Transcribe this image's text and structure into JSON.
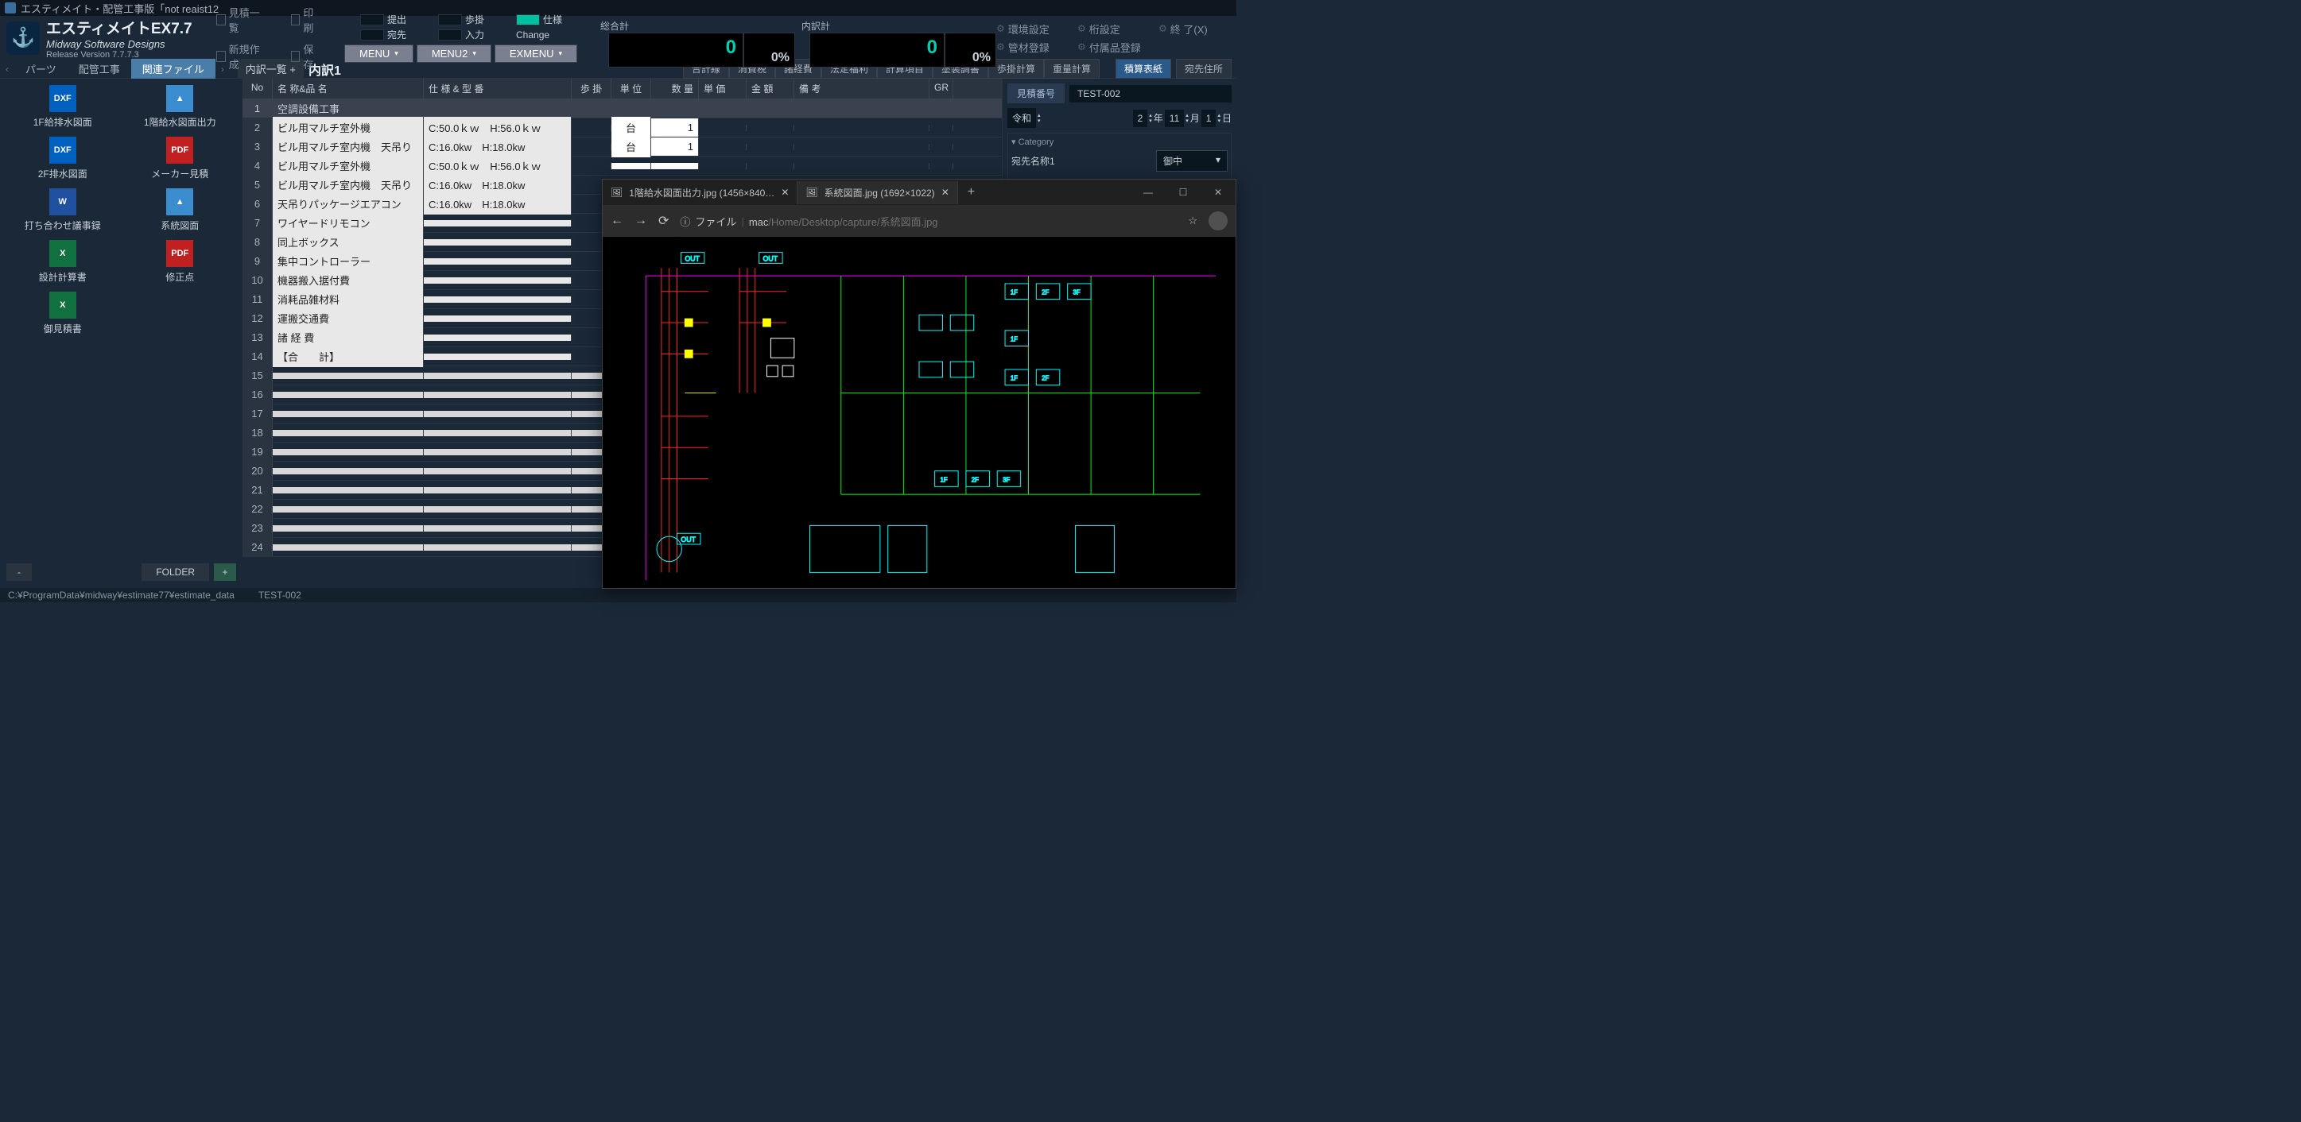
{
  "title": "エスティメイト・配管工事版「not reaist12",
  "logo": {
    "t1": "エスティメイトEX7.7",
    "t2": "Midway Software Designs",
    "t3": "Release Version 7.7.7.3"
  },
  "hdr_left": {
    "a": "見積一覧",
    "b": "印 刷",
    "c": "新規作成",
    "d": "保 存"
  },
  "toggles": {
    "a": "提出",
    "b": "歩掛",
    "c": "仕様",
    "d": "宛先",
    "e": "入力",
    "f": "Change"
  },
  "menus": {
    "a": "MENU",
    "b": "MENU2",
    "c": "EXMENU"
  },
  "totals": {
    "l1": "総合計",
    "v1": "0",
    "p1": "0%",
    "l2": "内訳計",
    "v2": "0",
    "p2": "0%"
  },
  "rbtns": {
    "a": "環境設定",
    "b": "桁設定",
    "c": "終 了(X)",
    "d": "管材登録",
    "e": "付属品登録"
  },
  "nav": {
    "a": "パーツ",
    "b": "配管工事",
    "c": "関連ファイル"
  },
  "bread": {
    "list": "内訳一覧",
    "cur": "内訳1"
  },
  "fn": [
    "合計線",
    "消費税",
    "諸経費",
    "法定福利",
    "計算項目",
    "塗装調書",
    "歩掛計算",
    "重量計算"
  ],
  "files": [
    {
      "icon": "dxf",
      "label": "1F給排水図面"
    },
    {
      "icon": "img",
      "label": "1階給水図面出力"
    },
    {
      "icon": "dxf",
      "label": "2F排水図面"
    },
    {
      "icon": "pdf",
      "label": "メーカー見積"
    },
    {
      "icon": "doc",
      "label": "打ち合わせ議事録"
    },
    {
      "icon": "img",
      "label": "系統図面"
    },
    {
      "icon": "xls",
      "label": "設計計算書"
    },
    {
      "icon": "pdf",
      "label": "修正点"
    },
    {
      "icon": "xls",
      "label": "御見積書"
    }
  ],
  "left_foot": {
    "folder": "FOLDER",
    "plus": "+",
    "dash": "-"
  },
  "cols": {
    "no": "No",
    "name": "名 称&品 名",
    "spec": "仕 様 & 型 番",
    "step": "歩 掛",
    "unit": "単 位",
    "qty": "数 量",
    "price": "単 価",
    "amt": "金 額",
    "note": "備 考",
    "gr": "GR"
  },
  "rows": [
    {
      "no": 1,
      "name": "空調設備工事",
      "spec": "",
      "unit": "",
      "qty": "",
      "hdr": true
    },
    {
      "no": 2,
      "name": "ビル用マルチ室外機",
      "spec": "C:50.0ｋｗ　H:56.0ｋｗ",
      "unit": "台",
      "qty": "1"
    },
    {
      "no": 3,
      "name": "ビル用マルチ室内機　天吊り",
      "spec": "C:16.0kw　H:18.0kw",
      "unit": "台",
      "qty": "1"
    },
    {
      "no": 4,
      "name": "ビル用マルチ室外機",
      "spec": "C:50.0ｋｗ　H:56.0ｋｗ",
      "unit": "",
      "qty": ""
    },
    {
      "no": 5,
      "name": "ビル用マルチ室内機　天吊り",
      "spec": "C:16.0kw　H:18.0kw",
      "unit": "",
      "qty": ""
    },
    {
      "no": 6,
      "name": "天吊りパッケージエアコン",
      "spec": "C:16.0kw　H:18.0kw",
      "unit": "",
      "qty": ""
    },
    {
      "no": 7,
      "name": "ワイヤードリモコン",
      "spec": "",
      "unit": "",
      "qty": ""
    },
    {
      "no": 8,
      "name": "同上ボックス",
      "spec": "",
      "unit": "",
      "qty": ""
    },
    {
      "no": 9,
      "name": "集中コントローラー",
      "spec": "",
      "unit": "",
      "qty": ""
    },
    {
      "no": 10,
      "name": "機器搬入据付費",
      "spec": "",
      "unit": "",
      "qty": ""
    },
    {
      "no": 11,
      "name": "消耗品雑材料",
      "spec": "",
      "unit": "",
      "qty": ""
    },
    {
      "no": 12,
      "name": "運搬交通費",
      "spec": "",
      "unit": "",
      "qty": ""
    },
    {
      "no": 13,
      "name": "諸 経 費",
      "spec": "",
      "unit": "",
      "qty": ""
    },
    {
      "no": 14,
      "name": "【合　　計】",
      "spec": "",
      "unit": "",
      "qty": ""
    },
    {
      "no": 15,
      "empty": true
    },
    {
      "no": 16,
      "empty": true
    },
    {
      "no": 17,
      "empty": true
    },
    {
      "no": 18,
      "empty": true
    },
    {
      "no": 19,
      "empty": true
    },
    {
      "no": 20,
      "empty": true
    },
    {
      "no": 21,
      "empty": true
    },
    {
      "no": 22,
      "empty": true
    },
    {
      "no": 23,
      "empty": true
    },
    {
      "no": 24,
      "empty": true
    }
  ],
  "right": {
    "b1": "積算表紙",
    "b2": "宛先住所",
    "est_lbl": "見積番号",
    "est_val": "TEST-002",
    "era": "令和",
    "yy": "2",
    "y": "年",
    "mm": "11",
    "m": "月",
    "dd": "1",
    "d": "日",
    "cat": "Category",
    "dest_lbl": "宛先名称1",
    "dest_val": "御中"
  },
  "status": {
    "path": "C:¥ProgramData¥midway¥estimate77¥estimate_data",
    "id": "TEST-002"
  },
  "viewer": {
    "tab1": "1階給水図面出力.jpg (1456×840…",
    "tab2": "系統図面.jpg (1692×1022)",
    "file_lbl": "ファイル",
    "path_pre": "mac",
    "path": "/Home/Desktop/capture/系統図面.jpg"
  }
}
